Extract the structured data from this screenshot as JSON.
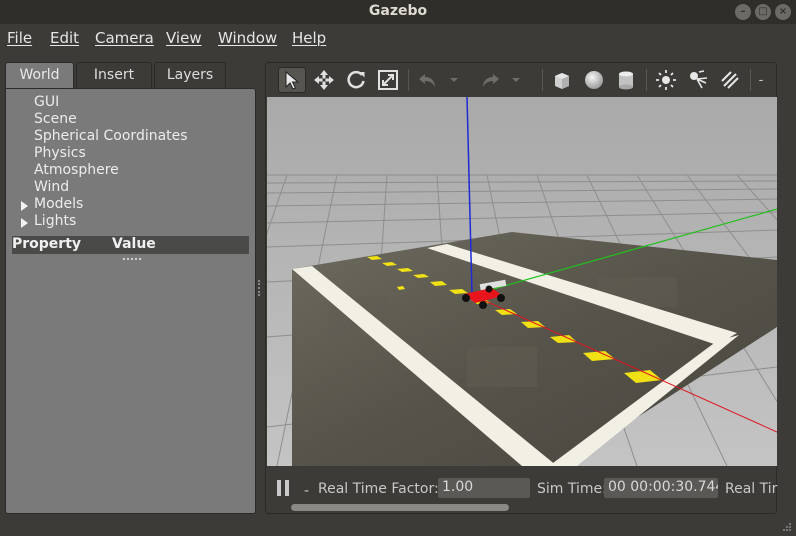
{
  "window": {
    "title": "Gazebo",
    "controls": [
      "minimize-icon",
      "maximize-icon",
      "close-icon"
    ]
  },
  "menu": [
    "File",
    "Edit",
    "Camera",
    "View",
    "Window",
    "Help"
  ],
  "left_panel": {
    "tabs": [
      "World",
      "Insert",
      "Layers"
    ],
    "active_tab": "World",
    "tree": [
      {
        "label": "GUI",
        "expandable": false
      },
      {
        "label": "Scene",
        "expandable": false
      },
      {
        "label": "Spherical Coordinates",
        "expandable": false
      },
      {
        "label": "Physics",
        "expandable": false
      },
      {
        "label": "Atmosphere",
        "expandable": false
      },
      {
        "label": "Wind",
        "expandable": false
      },
      {
        "label": "Models",
        "expandable": true
      },
      {
        "label": "Lights",
        "expandable": true
      }
    ],
    "property_header": {
      "property": "Property",
      "value": "Value"
    }
  },
  "toolbar": {
    "tools": [
      "select-arrow-icon",
      "translate-icon",
      "rotate-icon",
      "scale-icon",
      "undo-icon",
      "undo-dropdown-icon",
      "redo-icon",
      "redo-dropdown-icon",
      "box-icon",
      "sphere-icon",
      "cylinder-icon",
      "point-light-icon",
      "spot-light-icon",
      "directional-light-icon"
    ],
    "selected": "select-arrow-icon",
    "overflow": "-"
  },
  "status": {
    "step_dash": "-",
    "real_time_factor_label": "Real Time Factor:",
    "real_time_factor": "1.00",
    "sim_time_label": "Sim Time:",
    "sim_time": "00 00:00:30.744",
    "real_time_label": "Real Tir"
  },
  "colors": {
    "x_axis": "#e0141e",
    "y_axis": "#22c01e",
    "z_axis": "#1e2ad8",
    "robot": "#e8141c",
    "lane_dash": "#f0e014",
    "viewport_bg": "#b5b5b5"
  }
}
